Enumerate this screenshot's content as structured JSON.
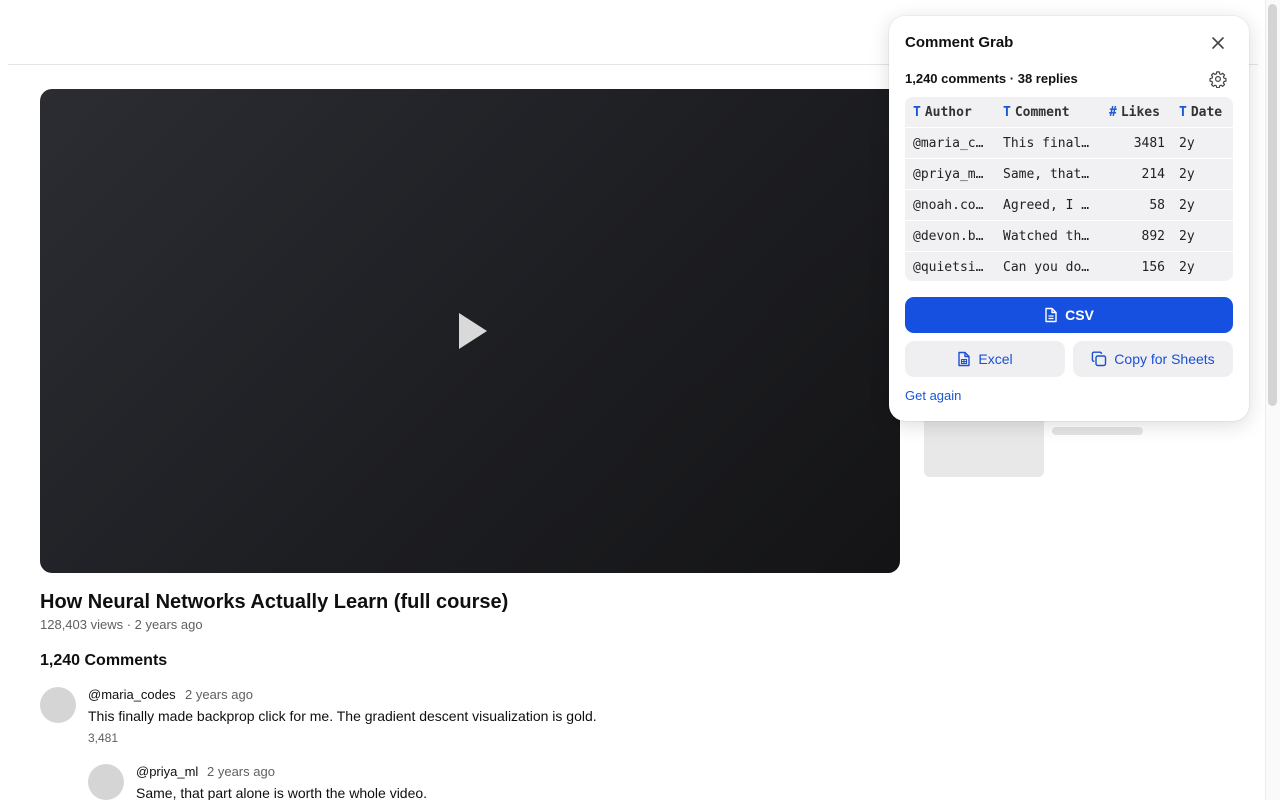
{
  "video": {
    "title": "How Neural Networks Actually Learn (full course)",
    "meta": "128,403 views · 2 years ago"
  },
  "comments_section": {
    "heading": "1,240 Comments",
    "items": [
      {
        "author": "@maria_codes",
        "time": "2 years ago",
        "text": "This finally made backprop click for me. The gradient descent visualization is gold.",
        "likes": "3,481"
      },
      {
        "author": "@priya_ml",
        "time": "2 years ago",
        "text": "Same, that part alone is worth the whole video."
      }
    ]
  },
  "panel": {
    "title": "Comment Grab",
    "summary": "1,240 comments · 38 replies",
    "columns": [
      {
        "type": "T",
        "label": "Author"
      },
      {
        "type": "T",
        "label": "Comment"
      },
      {
        "type": "#",
        "label": "Likes"
      },
      {
        "type": "T",
        "label": "Date"
      }
    ],
    "rows": [
      {
        "author": "@maria_c…",
        "comment": "This final…",
        "likes": "3481",
        "date": "2y"
      },
      {
        "author": "@priya_m…",
        "comment": "Same, that…",
        "likes": "214",
        "date": "2y"
      },
      {
        "author": "@noah.co…",
        "comment": "Agreed, I …",
        "likes": "58",
        "date": "2y"
      },
      {
        "author": "@devon.b…",
        "comment": "Watched th…",
        "likes": "892",
        "date": "2y"
      },
      {
        "author": "@quietsi…",
        "comment": "Can you do…",
        "likes": "156",
        "date": "2y"
      }
    ],
    "csv_label": "CSV",
    "excel_label": "Excel",
    "copy_label": "Copy for Sheets",
    "again_label": "Get again",
    "accent_color": "#1550e0"
  },
  "icons": {
    "close": "close-icon",
    "settings": "gear-icon",
    "csv": "file-icon",
    "excel": "spreadsheet-file-icon",
    "copy": "copy-icon",
    "play": "play-icon"
  }
}
